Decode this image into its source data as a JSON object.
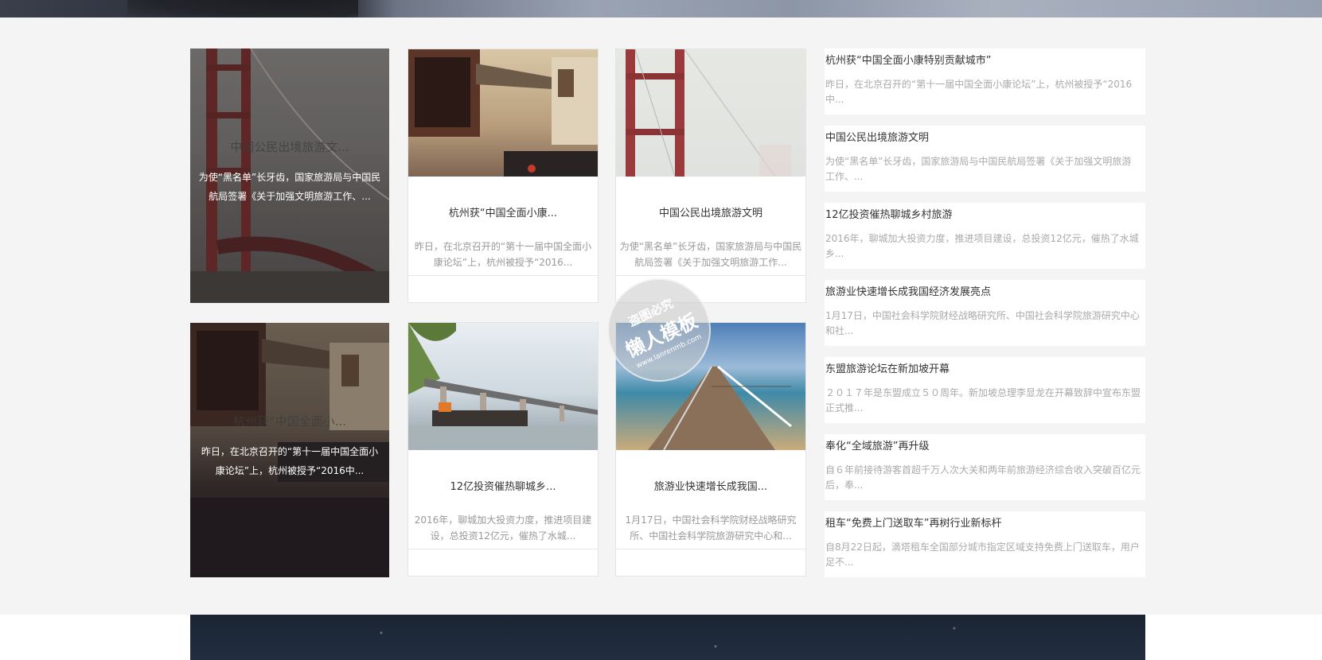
{
  "overlay_cards": [
    {
      "ghost_title": "中国公民出境旅游文...",
      "desc": "为使“黑名单”长牙齿，国家旅游局与中国民航局签署《关于加强文明旅游工作、..."
    },
    {
      "ghost_title": "杭州获“中国全面小...",
      "desc": "昨日，在北京召开的“第十一届中国全面小康论坛”上，杭州被授予“2016中..."
    }
  ],
  "std_cards": [
    {
      "title": "杭州获“中国全面小康...",
      "desc": "昨日，在北京召开的“第十一届中国全面小康论坛”上，杭州被授予“2016..."
    },
    {
      "title": "中国公民出境旅游文明",
      "desc": "为使“黑名单”长牙齿，国家旅游局与中国民航局签署《关于加强文明旅游工作..."
    },
    {
      "title": "12亿投资催热聊城乡...",
      "desc": "2016年，聊城加大投资力度，推进项目建设，总投资12亿元，催热了水城..."
    },
    {
      "title": "旅游业快速增长成我国...",
      "desc": "1月17日，中国社会科学院财经战略研究所、中国社会科学院旅游研究中心和..."
    }
  ],
  "news_list": [
    {
      "title": "杭州获“中国全面小康特别贡献城市”",
      "desc": "昨日，在北京召开的“第十一届中国全面小康论坛”上，杭州被授予“2016中..."
    },
    {
      "title": "中国公民出境旅游文明",
      "desc": "为使“黑名单”长牙齿，国家旅游局与中国民航局签署《关于加强文明旅游工作、..."
    },
    {
      "title": "12亿投资催热聊城乡村旅游",
      "desc": "2016年，聊城加大投资力度，推进项目建设，总投资12亿元，催热了水城乡..."
    },
    {
      "title": "旅游业快速增长成我国经济发展亮点",
      "desc": "1月17日，中国社会科学院财经战略研究所、中国社会科学院旅游研究中心和社..."
    },
    {
      "title": "东盟旅游论坛在新加坡开幕",
      "desc": "２０１７年是东盟成立５０周年。新加坡总理李显龙在开幕致辞中宣布东盟正式推..."
    },
    {
      "title": "奉化“全域旅游”再升级",
      "desc": "自６年前接待游客首超千万人次大关和两年前旅游经济综合收入突破百亿元后，奉..."
    },
    {
      "title": "租车“免费上门送取车”再树行业新标杆",
      "desc": "自8月22日起，滴塔租车全国部分城市指定区域支持免费上门送取车，用户足不..."
    }
  ],
  "watermark": {
    "line1": "盗图必究",
    "line2": "懒人模板",
    "line3": "www.lanrenmb.com"
  }
}
